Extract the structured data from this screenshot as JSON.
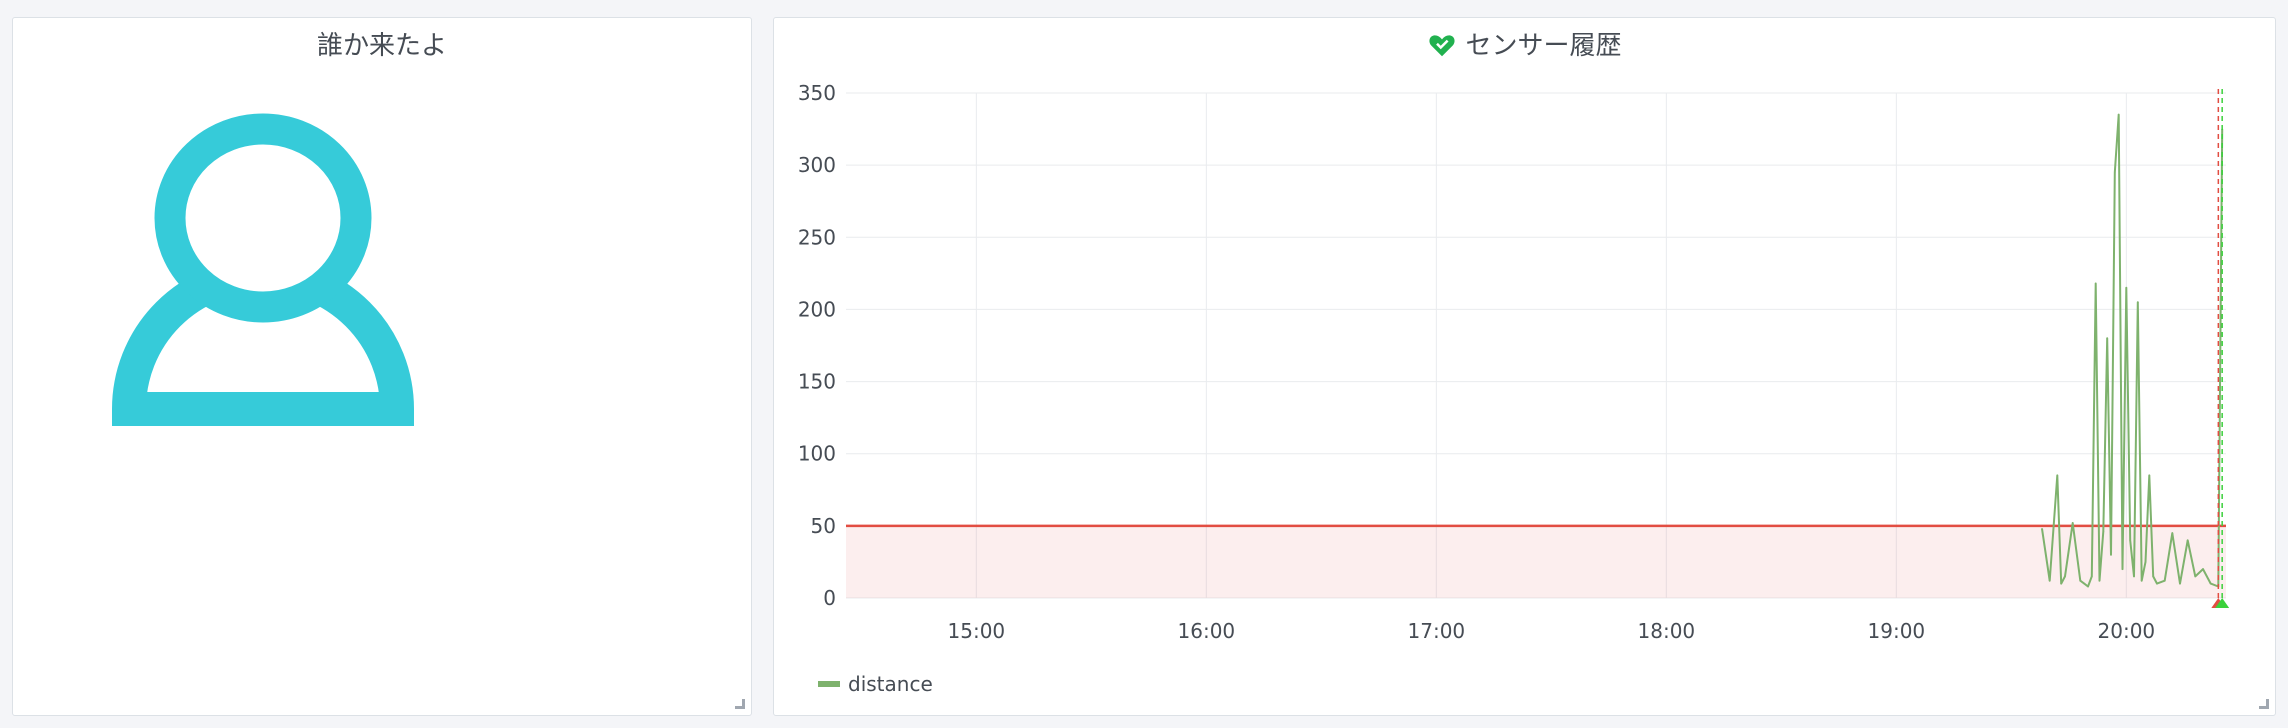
{
  "panels": {
    "visitor": {
      "title": "誰か来たよ",
      "icon": "person-icon",
      "icon_color": "#36cbd9"
    },
    "history": {
      "title": "センサー履歴",
      "title_icon": "heart-icon",
      "title_icon_color": "#21b14f"
    }
  },
  "chart_data": {
    "type": "line",
    "title": "センサー履歴",
    "xlabel": "",
    "ylabel": "",
    "ylim": [
      0,
      350
    ],
    "yticks": [
      "0",
      "50",
      "100",
      "150",
      "200",
      "250",
      "300",
      "350"
    ],
    "xlim": [
      "14:26",
      "20:26"
    ],
    "xticks": [
      "15:00",
      "16:00",
      "17:00",
      "18:00",
      "19:00",
      "20:00"
    ],
    "grid": true,
    "legend_position": "bottom-left",
    "series": [
      {
        "name": "distance",
        "color": "#7eb26d",
        "x": [
          "19:38",
          "19:40",
          "19:42",
          "19:43",
          "19:44",
          "19:46",
          "19:48",
          "19:49",
          "19:50",
          "19:51",
          "19:52",
          "19:53",
          "19:54",
          "19:55",
          "19:56",
          "19:57",
          "19:58",
          "19:59",
          "20:00",
          "20:01",
          "20:02",
          "20:03",
          "20:04",
          "20:05",
          "20:06",
          "20:07",
          "20:08",
          "20:10",
          "20:12",
          "20:14",
          "20:16",
          "20:18",
          "20:20",
          "20:22",
          "20:24",
          "20:25"
        ],
        "y": [
          48,
          12,
          85,
          10,
          15,
          52,
          12,
          10,
          8,
          15,
          218,
          12,
          46,
          180,
          30,
          295,
          335,
          20,
          215,
          40,
          15,
          205,
          12,
          25,
          85,
          15,
          10,
          12,
          45,
          10,
          40,
          15,
          20,
          10,
          8,
          325
        ]
      }
    ],
    "threshold": {
      "value": 50,
      "color": "#e24d42",
      "fill": "rgba(234,112,112,0.12)"
    },
    "annotations": [
      {
        "time": "20:24",
        "color": "#e24d42"
      },
      {
        "time": "20:25",
        "color": "#3bd13b"
      }
    ]
  },
  "legend": {
    "items": [
      {
        "label": "distance",
        "color": "#7eb26d"
      }
    ]
  }
}
